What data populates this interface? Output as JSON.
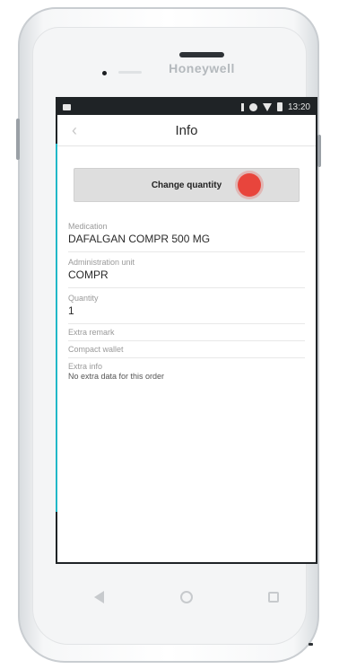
{
  "device": {
    "brand": "Honeywell"
  },
  "status_bar": {
    "time": "13:20"
  },
  "header": {
    "title": "Info",
    "back_icon": "chevron-left-icon"
  },
  "actions": {
    "change_quantity_label": "Change quantity"
  },
  "fields": {
    "medication": {
      "label": "Medication",
      "value": "DAFALGAN COMPR 500 MG"
    },
    "administration_unit": {
      "label": "Administration unit",
      "value": "COMPR"
    },
    "quantity": {
      "label": "Quantity",
      "value": "1"
    },
    "extra_remark": {
      "label": "Extra remark"
    },
    "compact_wallet": {
      "label": "Compact wallet"
    },
    "extra_info": {
      "label": "Extra info",
      "value": "No extra data for this order"
    }
  },
  "colors": {
    "accent": "#20b8c8",
    "tap_indicator": "#e8453c",
    "status_bar": "#1f2326"
  }
}
